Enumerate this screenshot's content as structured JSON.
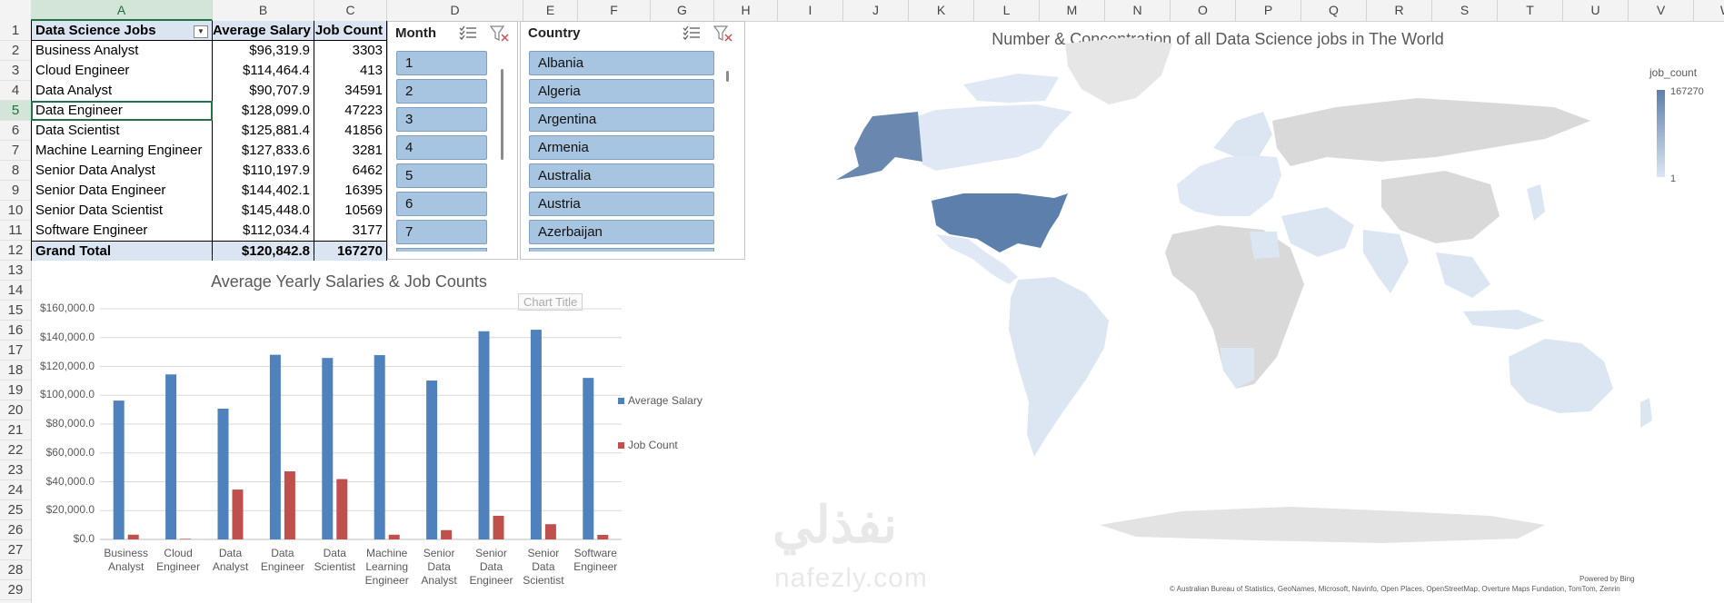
{
  "columns": [
    "A",
    "B",
    "C",
    "D",
    "E",
    "F",
    "G",
    "H",
    "I",
    "J",
    "K",
    "L",
    "M",
    "N",
    "O",
    "P",
    "Q",
    "R",
    "S",
    "T",
    "U",
    "V",
    "W"
  ],
  "active_column": "A",
  "rows": [
    "1",
    "2",
    "3",
    "4",
    "5",
    "6",
    "7",
    "8",
    "9",
    "10",
    "11",
    "12",
    "13",
    "14",
    "15",
    "16",
    "17",
    "18",
    "19",
    "20",
    "21",
    "22",
    "23",
    "24",
    "25",
    "26",
    "27",
    "28",
    "29"
  ],
  "active_row": "5",
  "pivot": {
    "headers": {
      "job": "Data Science Jobs",
      "salary": "Average Salary",
      "count": "Job Count"
    },
    "rows": [
      {
        "job": "Business Analyst",
        "salary": "$96,319.9",
        "count": "3303"
      },
      {
        "job": "Cloud Engineer",
        "salary": "$114,464.4",
        "count": "413"
      },
      {
        "job": "Data Analyst",
        "salary": "$90,707.9",
        "count": "34591"
      },
      {
        "job": "Data Engineer",
        "salary": "$128,099.0",
        "count": "47223"
      },
      {
        "job": "Data Scientist",
        "salary": "$125,881.4",
        "count": "41856"
      },
      {
        "job": "Machine Learning Engineer",
        "salary": "$127,833.6",
        "count": "3281"
      },
      {
        "job": "Senior Data Analyst",
        "salary": "$110,197.9",
        "count": "6462"
      },
      {
        "job": "Senior Data Engineer",
        "salary": "$144,402.1",
        "count": "16395"
      },
      {
        "job": "Senior Data Scientist",
        "salary": "$145,448.0",
        "count": "10569"
      },
      {
        "job": "Software Engineer",
        "salary": "$112,034.4",
        "count": "3177"
      }
    ],
    "total": {
      "job": "Grand Total",
      "salary": "$120,842.8",
      "count": "167270"
    }
  },
  "slicer_month": {
    "title": "Month",
    "items": [
      "1",
      "2",
      "3",
      "4",
      "5",
      "6",
      "7"
    ]
  },
  "slicer_country": {
    "title": "Country",
    "items": [
      "Albania",
      "Algeria",
      "Argentina",
      "Armenia",
      "Australia",
      "Austria",
      "Azerbaijan"
    ]
  },
  "icons": {
    "multiselect": "multi-select-icon",
    "clear_filter": "clear-filter-icon",
    "dropdown": "filter-dropdown-icon"
  },
  "chart_data": [
    {
      "type": "bar",
      "title": "Average Yearly Salaries & Job Counts",
      "tooltip": "Chart Title",
      "categories": [
        "Business Analyst",
        "Cloud Engineer",
        "Data Analyst",
        "Data Engineer",
        "Data Scientist",
        "Machine Learning Engineer",
        "Senior Data Analyst",
        "Senior Data Engineer",
        "Senior Data Scientist",
        "Software Engineer"
      ],
      "category_lines": [
        [
          "Business",
          "Analyst"
        ],
        [
          "Cloud",
          "Engineer"
        ],
        [
          "Data",
          "Analyst"
        ],
        [
          "Data",
          "Engineer"
        ],
        [
          "Data",
          "Scientist"
        ],
        [
          "Machine",
          "Learning",
          "Engineer"
        ],
        [
          "Senior",
          "Data",
          "Analyst"
        ],
        [
          "Senior",
          "Data",
          "Engineer"
        ],
        [
          "Senior",
          "Data",
          "Scientist"
        ],
        [
          "Software",
          "Engineer"
        ]
      ],
      "series": [
        {
          "name": "Average Salary",
          "color": "#4f81bd",
          "values": [
            96319.9,
            114464.4,
            90707.9,
            128099.0,
            125881.4,
            127833.6,
            110197.9,
            144402.1,
            145448.0,
            112034.4
          ]
        },
        {
          "name": "Job Count",
          "color": "#c0504d",
          "values": [
            3303,
            413,
            34591,
            47223,
            41856,
            3281,
            6462,
            16395,
            10569,
            3177
          ]
        }
      ],
      "yticks": [
        "$0.0",
        "$20,000.0",
        "$40,000.0",
        "$60,000.0",
        "$80,000.0",
        "$100,000.0",
        "$120,000.0",
        "$140,000.0",
        "$160,000.0"
      ],
      "ylim": [
        0,
        160000
      ],
      "legend": "right"
    },
    {
      "type": "heatmap",
      "title": "Number & Concentration of all Data Science jobs in The World",
      "legend_title": "job_count",
      "legend_max": "167270",
      "legend_min": "1",
      "color_max": "#5d7fab",
      "color_min": "#dce6f3",
      "no_data_color": "#d9d9d9"
    }
  ],
  "map_attribution": {
    "powered": "Powered by Bing",
    "credits": "© Australian Bureau of Statistics, GeoNames, Microsoft, Navinfo, Open Places, OpenStreetMap, Overture Maps Fundation, TomTom, Zenrin"
  },
  "watermark": {
    "arabic": "نفذلي",
    "latin": "nafezly.com"
  }
}
